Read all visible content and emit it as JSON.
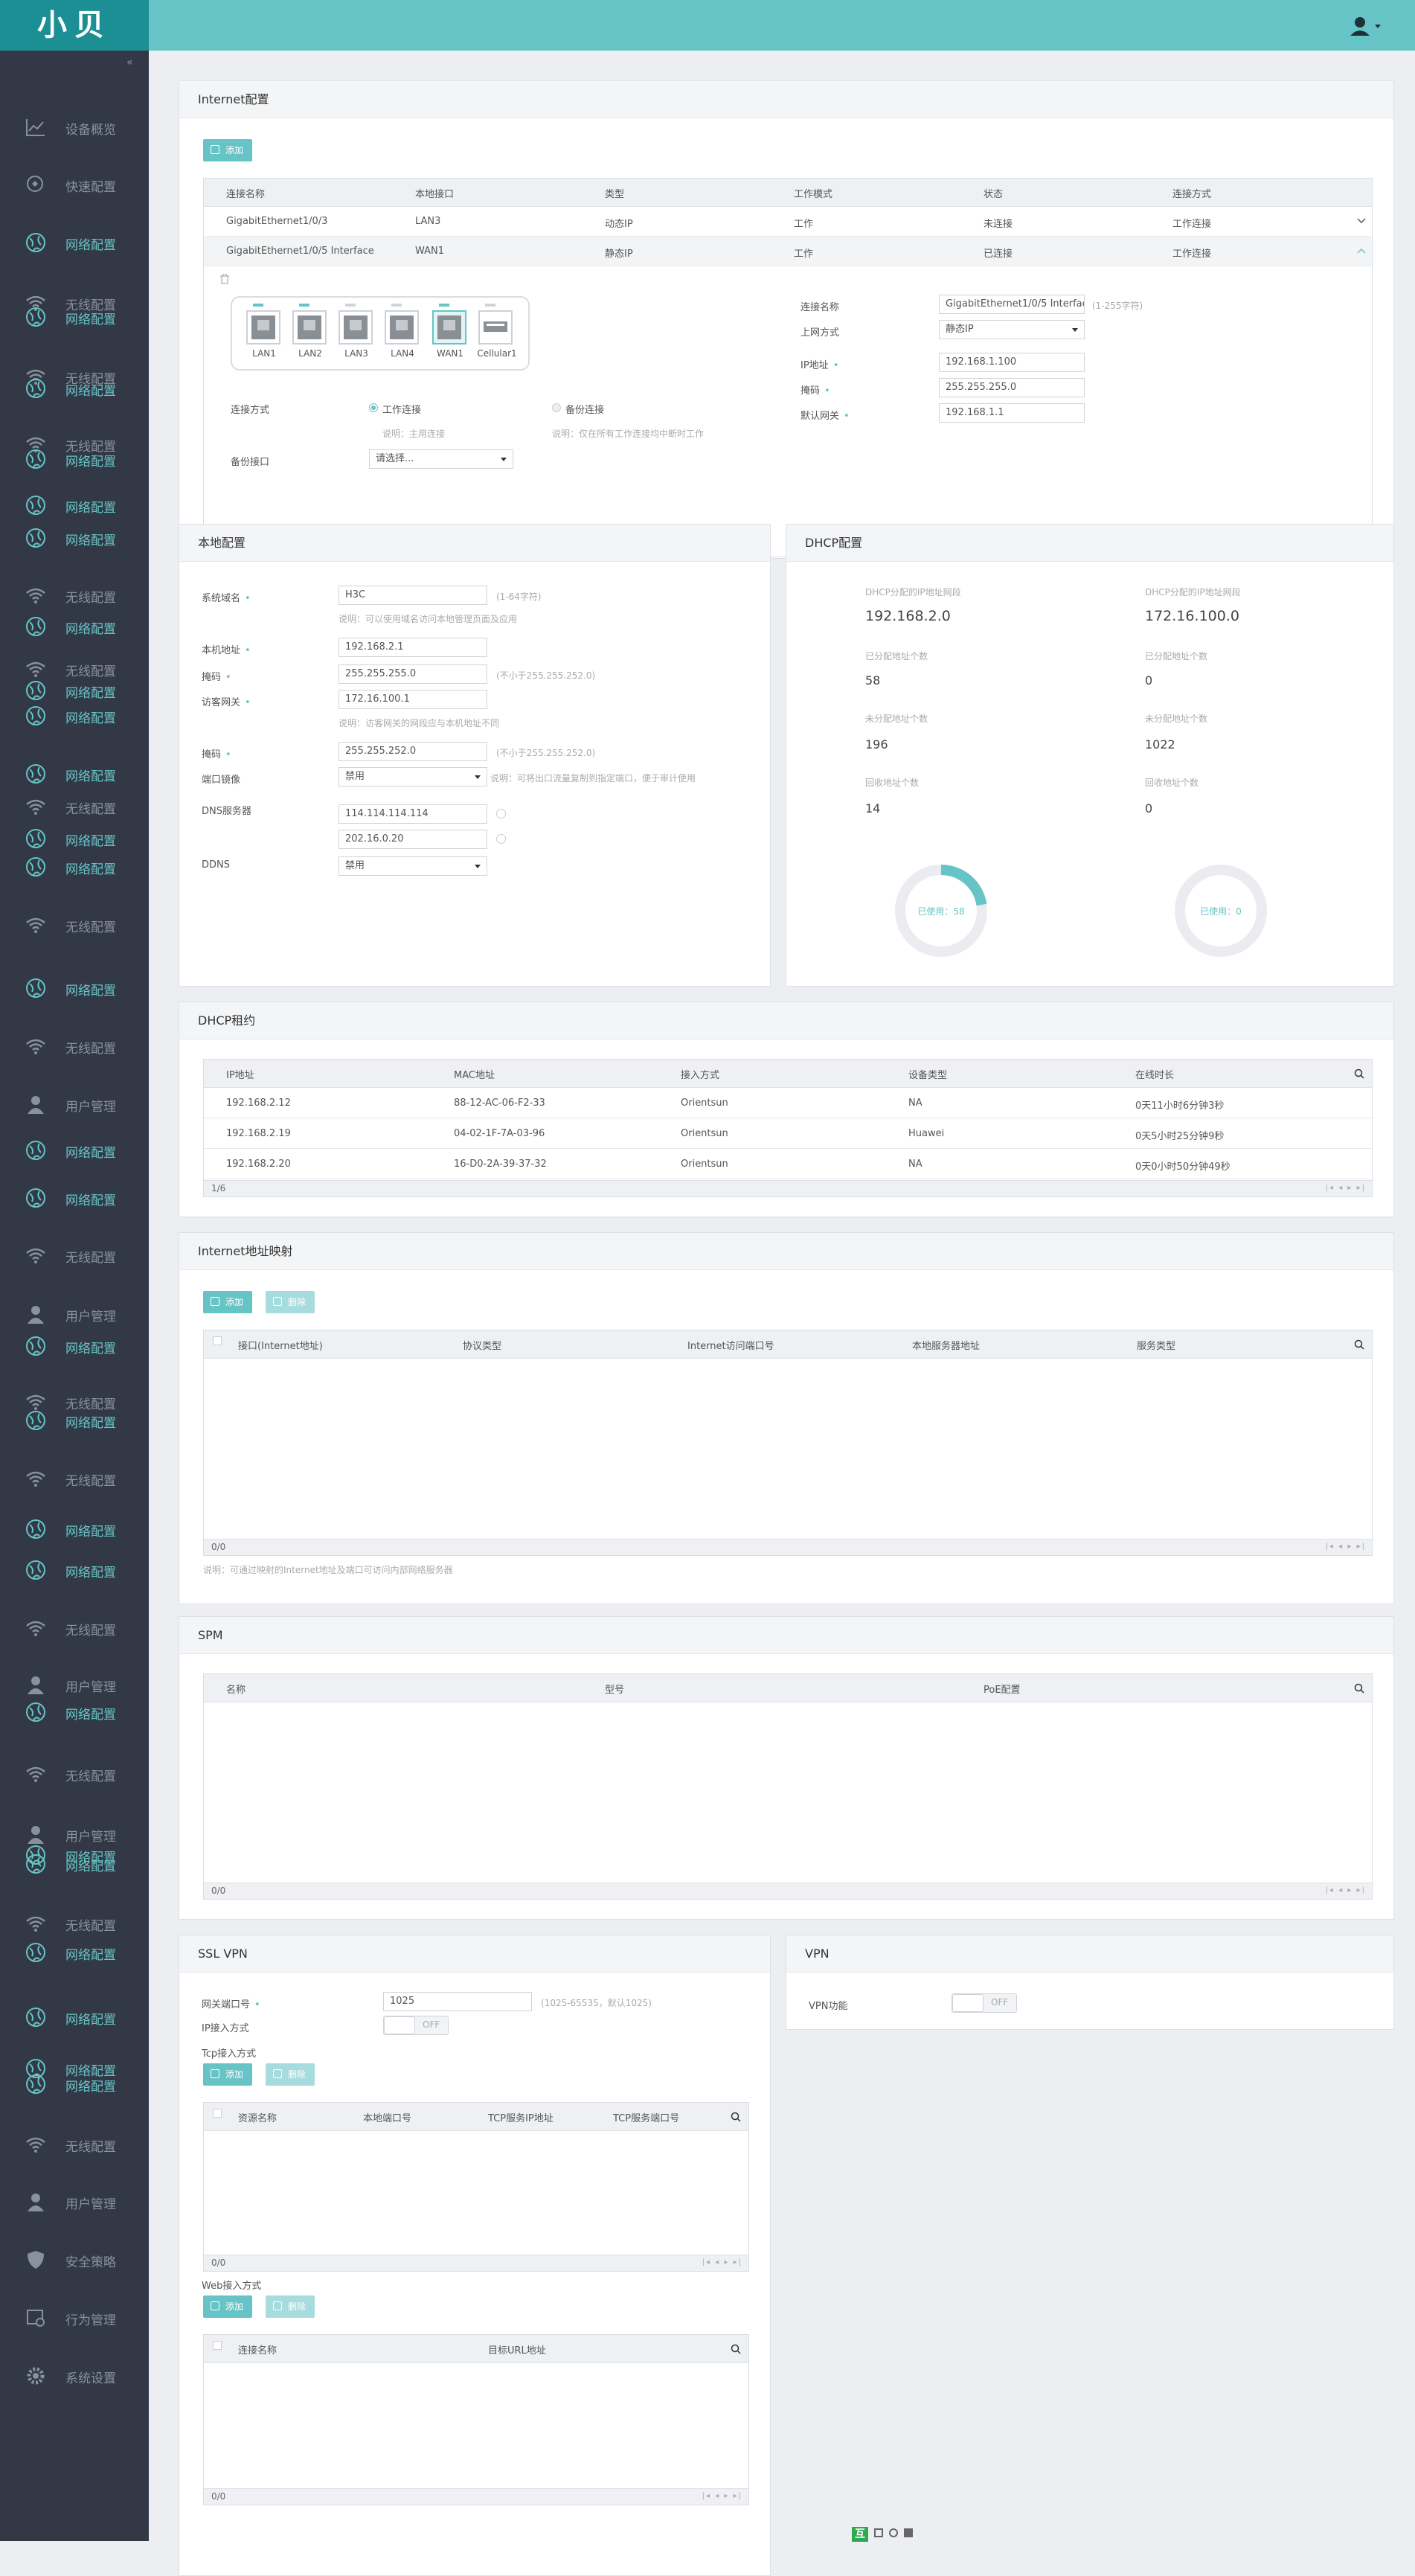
{
  "app": {
    "logo": "小贝"
  },
  "sidebar": {
    "collapse": "«",
    "items": [
      {
        "label": "设备概览",
        "icon": "line-chart-icon"
      },
      {
        "label": "快速配置",
        "icon": "quick-config-icon"
      },
      {
        "label": "网络配置",
        "icon": "globe-icon"
      },
      {
        "label": "无线配置",
        "icon": "wifi-icon"
      },
      {
        "label": "网络配置",
        "icon": "globe-icon"
      },
      {
        "label": "无线配置",
        "icon": "wifi-icon"
      },
      {
        "label": "网络配置",
        "icon": "globe-icon"
      },
      {
        "label": "无线配置",
        "icon": "wifi-icon"
      },
      {
        "label": "网络配置",
        "icon": "globe-icon"
      },
      {
        "label": "网络配置",
        "icon": "globe-icon"
      },
      {
        "label": "网络配置",
        "icon": "globe-icon"
      },
      {
        "label": "无线配置",
        "icon": "wifi-icon"
      },
      {
        "label": "网络配置",
        "icon": "globe-icon"
      },
      {
        "label": "无线配置",
        "icon": "wifi-icon"
      },
      {
        "label": "网络配置",
        "icon": "globe-icon"
      },
      {
        "label": "网络配置",
        "icon": "globe-icon"
      },
      {
        "label": "网络配置",
        "icon": "globe-icon"
      },
      {
        "label": "无线配置",
        "icon": "wifi-icon"
      },
      {
        "label": "网络配置",
        "icon": "globe-icon"
      },
      {
        "label": "网络配置",
        "icon": "globe-icon"
      },
      {
        "label": "无线配置",
        "icon": "wifi-icon"
      },
      {
        "label": "网络配置",
        "icon": "globe-icon"
      },
      {
        "label": "无线配置",
        "icon": "wifi-icon"
      },
      {
        "label": "用户管理",
        "icon": "user-icon"
      },
      {
        "label": "网络配置",
        "icon": "globe-icon"
      },
      {
        "label": "网络配置",
        "icon": "globe-icon"
      },
      {
        "label": "无线配置",
        "icon": "wifi-icon"
      },
      {
        "label": "用户管理",
        "icon": "user-icon"
      },
      {
        "label": "网络配置",
        "icon": "globe-icon"
      },
      {
        "label": "无线配置",
        "icon": "wifi-icon"
      },
      {
        "label": "网络配置",
        "icon": "globe-icon"
      },
      {
        "label": "无线配置",
        "icon": "wifi-icon"
      },
      {
        "label": "网络配置",
        "icon": "globe-icon"
      },
      {
        "label": "网络配置",
        "icon": "globe-icon"
      },
      {
        "label": "无线配置",
        "icon": "wifi-icon"
      },
      {
        "label": "用户管理",
        "icon": "user-icon"
      },
      {
        "label": "网络配置",
        "icon": "globe-icon"
      },
      {
        "label": "无线配置",
        "icon": "wifi-icon"
      },
      {
        "label": "用户管理",
        "icon": "user-icon"
      },
      {
        "label": "网络配置",
        "icon": "globe-icon"
      },
      {
        "label": "网络配置",
        "icon": "globe-icon"
      },
      {
        "label": "无线配置",
        "icon": "wifi-icon"
      },
      {
        "label": "网络配置",
        "icon": "globe-icon"
      },
      {
        "label": "网络配置",
        "icon": "globe-icon"
      },
      {
        "label": "网络配置",
        "icon": "globe-icon"
      },
      {
        "label": "网络配置",
        "icon": "globe-icon"
      },
      {
        "label": "无线配置",
        "icon": "wifi-icon"
      },
      {
        "label": "用户管理",
        "icon": "user-icon"
      },
      {
        "label": "安全策略",
        "icon": "shield-icon"
      },
      {
        "label": "行为管理",
        "icon": "behavior-icon"
      },
      {
        "label": "系统设置",
        "icon": "gear-icon"
      }
    ]
  },
  "internet": {
    "title": "Internet配置",
    "add": "添加",
    "headers": [
      "连接名称",
      "本地接口",
      "类型",
      "工作模式",
      "状态",
      "连接方式"
    ],
    "rows": [
      [
        "GigabitEthernet1/0/3",
        "LAN3",
        "动态IP",
        "工作",
        "未连接",
        "工作连接"
      ],
      [
        "GigabitEthernet1/0/5 Interface",
        "WAN1",
        "静态IP",
        "工作",
        "已连接",
        "工作连接"
      ]
    ],
    "ports": [
      "LAN1",
      "LAN2",
      "LAN3",
      "LAN4",
      "WAN1",
      "Cellular1"
    ],
    "conn_mode_label": "连接方式",
    "work_conn": "工作连接",
    "backup_conn": "备份连接",
    "work_note": "说明：主用连接",
    "backup_note": "说明：仅在所有工作连接均中断时工作",
    "backup_if_label": "备份接口",
    "backup_if_placeholder": "请选择...",
    "form": {
      "name_label": "连接名称",
      "name_value": "GigabitEthernet1/0/5 Interface",
      "name_hint": "(1-255字符)",
      "up_label": "上网方式",
      "up_value": "静态IP",
      "ip_label": "IP地址",
      "ip_value": "192.168.1.100",
      "mask_label": "掩码",
      "mask_value": "255.255.255.0",
      "gw_label": "默认网关",
      "gw_value": "192.168.1.1"
    }
  },
  "local": {
    "title": "本地配置",
    "domain_label": "系统域名",
    "domain_value": "H3C",
    "domain_hint": "(1-64字符)",
    "domain_note": "说明：可以使用域名访问本地管理页面及应用",
    "ip_label": "本机地址",
    "ip_value": "192.168.2.1",
    "mask_label": "掩码",
    "mask_value": "255.255.255.0",
    "mask_hint": "(不小于255.255.252.0)",
    "guest_label": "访客网关",
    "guest_value": "172.16.100.1",
    "guest_note": "说明：访客网关的网段应与本机地址不同",
    "mask2_label": "掩码",
    "mask2_value": "255.255.252.0",
    "mask2_hint": "(不小于255.255.252.0)",
    "mirror_label": "端口镜像",
    "mirror_value": "禁用",
    "mirror_note": "说明：可将出口流量复制到指定端口，便于审计使用",
    "dns_label": "DNS服务器",
    "dns1": "114.114.114.114",
    "dns2": "202.16.0.20",
    "ddns_label": "DDNS",
    "ddns_value": "禁用"
  },
  "dhcp": {
    "title": "DHCP配置",
    "pools": [
      {
        "range_label": "DHCP分配的IP地址网段",
        "range": "192.168.2.0",
        "assigned_label": "已分配地址个数",
        "assigned": "58",
        "unassigned_label": "未分配地址个数",
        "unassigned": "196",
        "reclaimed_label": "回收地址个数",
        "reclaimed": "14",
        "donut_label": "已使用：58",
        "used_fraction": 0.2265
      },
      {
        "range_label": "DHCP分配的IP地址网段",
        "range": "172.16.100.0",
        "assigned_label": "已分配地址个数",
        "assigned": "0",
        "unassigned_label": "未分配地址个数",
        "unassigned": "1022",
        "reclaimed_label": "回收地址个数",
        "reclaimed": "0",
        "donut_label": "已使用：0",
        "used_fraction": 0
      }
    ]
  },
  "lease": {
    "title": "DHCP租约",
    "headers": [
      "IP地址",
      "MAC地址",
      "接入方式",
      "设备类型",
      "在线时长"
    ],
    "rows": [
      [
        "192.168.2.12",
        "88-12-AC-06-F2-33",
        "Orientsun",
        "NA",
        "0天11小时6分钟3秒"
      ],
      [
        "192.168.2.19",
        "04-02-1F-7A-03-96",
        "Orientsun",
        "Huawei",
        "0天5小时25分钟9秒"
      ],
      [
        "192.168.2.20",
        "16-D0-2A-39-37-32",
        "Orientsun",
        "NA",
        "0天0小时50分钟49秒"
      ]
    ],
    "page": "1/6"
  },
  "mapping": {
    "title": "Internet地址映射",
    "add": "添加",
    "delete": "删除",
    "headers": [
      "接口(Internet地址)",
      "协议类型",
      "Internet访问端口号",
      "本地服务器地址",
      "服务类型"
    ],
    "page": "0/0",
    "note": "说明：可通过映射的Internet地址及端口可访问内部网络服务器"
  },
  "spm": {
    "title": "SPM",
    "headers": [
      "名称",
      "型号",
      "PoE配置"
    ],
    "page": "0/0"
  },
  "sslvpn": {
    "title": "SSL VPN",
    "port_label": "网关端口号",
    "port_value": "1025",
    "port_hint": "(1025-65535，默认1025)",
    "ip_label": "IP接入方式",
    "toggle_off": "OFF",
    "tcp_label": "Tcp接入方式",
    "add": "添加",
    "delete": "删除",
    "tcp_headers": [
      "资源名称",
      "本地端口号",
      "TCP服务IP地址",
      "TCP服务端口号"
    ],
    "tcp_page": "0/0",
    "web_label": "Web接入方式",
    "web_headers": [
      "连接名称",
      "目标URL地址"
    ],
    "web_page": "0/0"
  },
  "vpn": {
    "title": "VPN",
    "func_label": "VPN功能",
    "toggle_off": "OFF"
  },
  "footer": {
    "logo": "互"
  },
  "colors": {
    "accent": "#67c4c6",
    "sidebar": "#323846",
    "logo_bg": "#1b8f93"
  }
}
